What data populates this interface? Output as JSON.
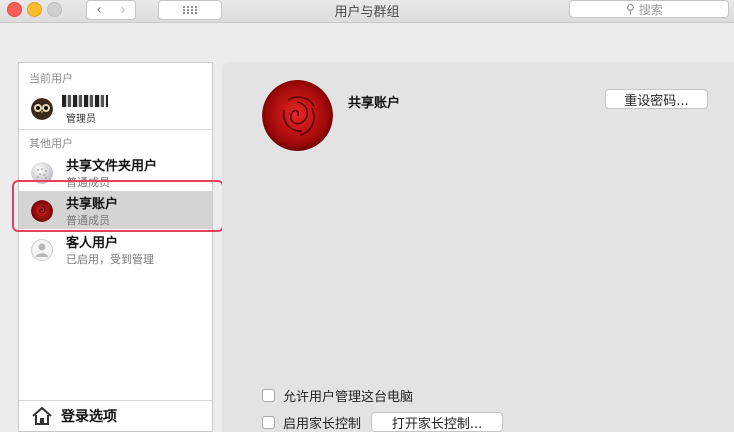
{
  "window": {
    "title": "用户与群组",
    "search_placeholder": "搜索",
    "nav_back_icon": "chevron-left-icon",
    "nav_forward_icon": "chevron-right-icon",
    "grid_icon": "grid-icon"
  },
  "sidebar": {
    "current_users_label": "当前用户",
    "current_user": {
      "role": "管理员"
    },
    "other_users_label": "其他用户",
    "other_users": [
      {
        "name": "共享文件夹用户",
        "role": "普通成员"
      },
      {
        "name": "共享账户",
        "role": "普通成员"
      },
      {
        "name": "客人用户",
        "role": "已启用，受到管理"
      }
    ],
    "login_options_label": "登录选项"
  },
  "main": {
    "account_name": "共享账户",
    "reset_password_label": "重设密码...",
    "allow_admin_label": "允许用户管理这台电脑",
    "parental_controls_label": "启用家长控制",
    "open_parental_controls_label": "打开家长控制..."
  },
  "colors": {
    "highlight_border": "#e8405a",
    "selected_row": "#d4d4d4"
  }
}
